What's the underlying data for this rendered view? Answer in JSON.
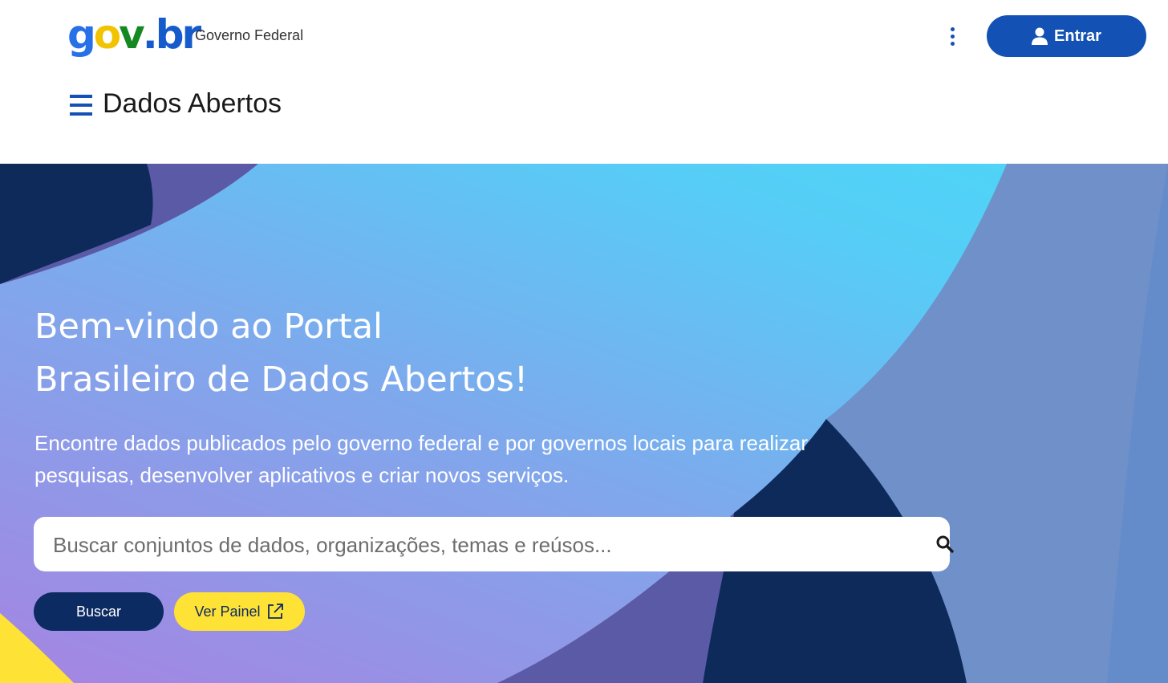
{
  "header": {
    "logo": {
      "part1": "g",
      "part2": "o",
      "part3": "v",
      "part4": ".",
      "part5": "br"
    },
    "gov_label": "Governo Federal",
    "login_label": "Entrar",
    "menu_icon": "kebab-menu-icon",
    "user_icon": "user-icon"
  },
  "nav": {
    "menu_icon": "hamburger-icon",
    "site_title": "Dados Abertos"
  },
  "hero": {
    "title_line1": "Bem-vindo ao Portal",
    "title_line2": "Brasileiro de Dados Abertos!",
    "desc_line1": "Encontre dados publicados pelo governo federal e por governos locais para realizar",
    "desc_line2": "pesquisas, desenvolver aplicativos e criar novos serviços.",
    "search": {
      "placeholder": "Buscar conjuntos de dados, organizações, temas e reúsos...",
      "value": "",
      "icon": "search-icon"
    },
    "buscar_label": "Buscar",
    "painel_label": "Ver Painel",
    "painel_icon": "external-link-icon"
  },
  "colors": {
    "primary_blue": "#1351b4",
    "dark_navy": "#0c2b63",
    "accent_yellow": "#ffe236",
    "hero_cyan": "#4cd6f8",
    "hero_purple": "#a584e2"
  }
}
